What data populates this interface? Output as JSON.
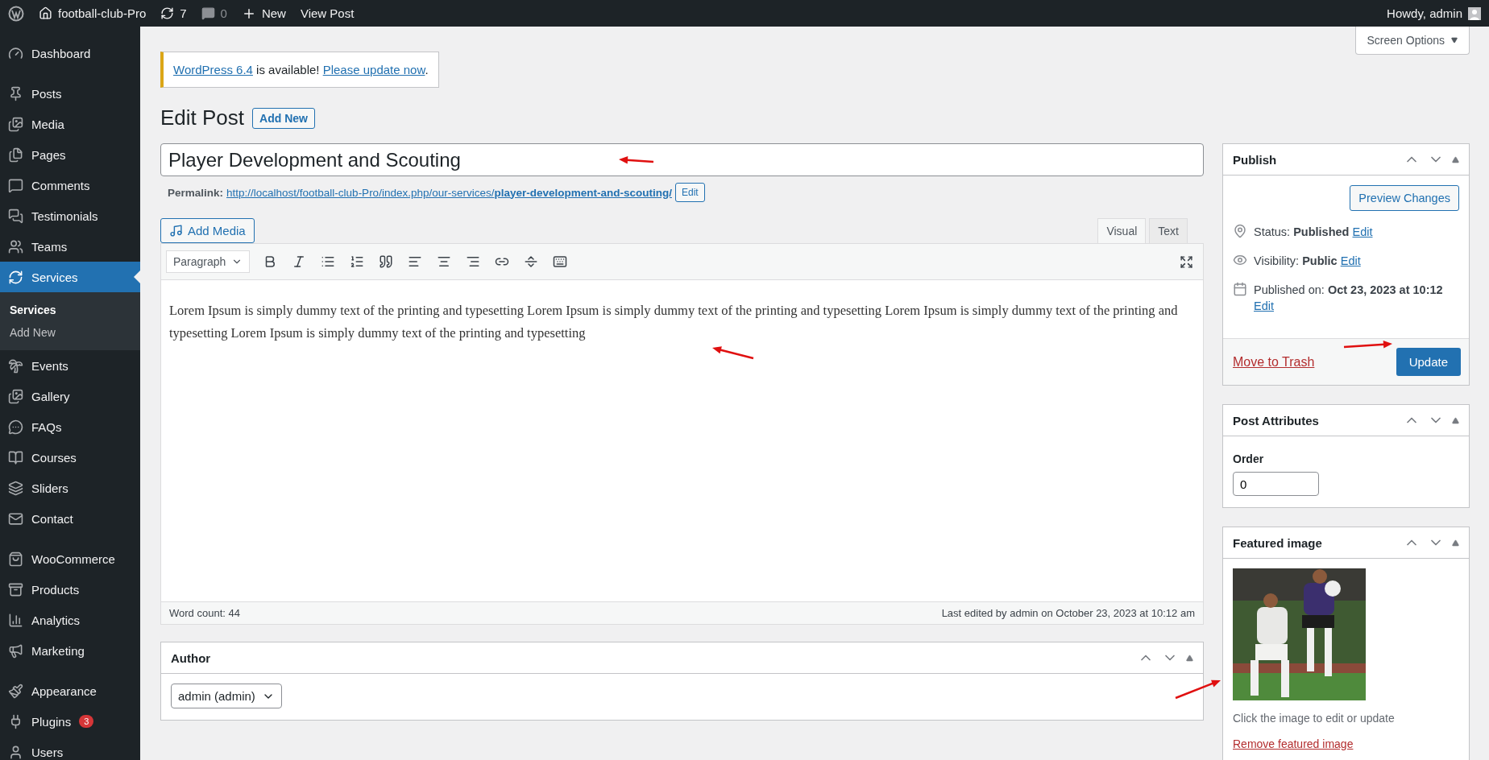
{
  "admin_bar": {
    "site": "football-club-Pro",
    "updates": "7",
    "comments": "0",
    "new": "New",
    "view": "View Post",
    "greeting": "Howdy, admin"
  },
  "sidebar": {
    "groups": [
      {
        "items": [
          {
            "label": "Dashboard",
            "selected": false
          }
        ]
      },
      {
        "items": [
          {
            "label": "Posts",
            "selected": false
          },
          {
            "label": "Media",
            "selected": false
          },
          {
            "label": "Pages",
            "selected": false
          },
          {
            "label": "Comments",
            "selected": false
          },
          {
            "label": "Testimonials",
            "selected": false
          },
          {
            "label": "Teams",
            "selected": false
          },
          {
            "label": "Services",
            "selected": true,
            "children": [
              {
                "label": "Services",
                "selected": true
              },
              {
                "label": "Add New",
                "selected": false
              }
            ]
          },
          {
            "label": "Events",
            "selected": false
          },
          {
            "label": "Gallery",
            "selected": false
          },
          {
            "label": "FAQs",
            "selected": false
          },
          {
            "label": "Courses",
            "selected": false
          },
          {
            "label": "Sliders",
            "selected": false
          },
          {
            "label": "Contact",
            "selected": false
          }
        ]
      },
      {
        "items": [
          {
            "label": "WooCommerce",
            "selected": false
          },
          {
            "label": "Products",
            "selected": false
          },
          {
            "label": "Analytics",
            "selected": false
          },
          {
            "label": "Marketing",
            "selected": false
          }
        ]
      },
      {
        "items": [
          {
            "label": "Appearance",
            "selected": false
          },
          {
            "label": "Plugins",
            "selected": false,
            "badge": "3"
          },
          {
            "label": "Users",
            "selected": false
          }
        ]
      }
    ]
  },
  "screen_options": "Screen Options",
  "notice": {
    "link_1": "WordPress 6.4",
    "text": "is available!",
    "link_2": "Please update now",
    "end": "."
  },
  "heading": "Edit Post",
  "add_new": "Add New",
  "title": "Player Development and Scouting",
  "permalink": {
    "label": "Permalink:",
    "url": "http://localhost/football-club-Pro/index.php/our-services/**player-development-and-scouting/**",
    "edit": "Edit"
  },
  "add_media": "Add Media",
  "tabs": [
    {
      "label": "Visual",
      "selected": true
    },
    {
      "label": "Text",
      "selected": false
    }
  ],
  "format": "Paragraph",
  "content": "Lorem Ipsum is simply dummy text of the printing and typesetting Lorem Ipsum is simply dummy text of the printing and typesetting Lorem Ipsum is simply dummy text of the printing and typesetting Lorem Ipsum is simply dummy text of the printing and typesetting",
  "word_count": "Word count: 44",
  "last_edited": "Last edited by admin on October 23, 2023 at 10:12 am",
  "author": {
    "title": "Author",
    "value": "admin (admin)"
  },
  "publish": {
    "title": "Publish",
    "preview": "Preview Changes",
    "rows": [
      {
        "label": "Status:",
        "value": "Published",
        "link": "Edit"
      },
      {
        "label": "Visibility:",
        "value": "Public",
        "link": "Edit"
      },
      {
        "label": "Published on:",
        "value": "Oct 23, 2023 at 10:12",
        "link": "Edit"
      }
    ],
    "trash": "Move to Trash",
    "update": "Update"
  },
  "attributes": {
    "title": "Post Attributes",
    "label": "Order",
    "value": "0"
  },
  "featured": {
    "title": "Featured image",
    "caption": "Click the image to edit or update",
    "remove": "Remove featured image"
  }
}
